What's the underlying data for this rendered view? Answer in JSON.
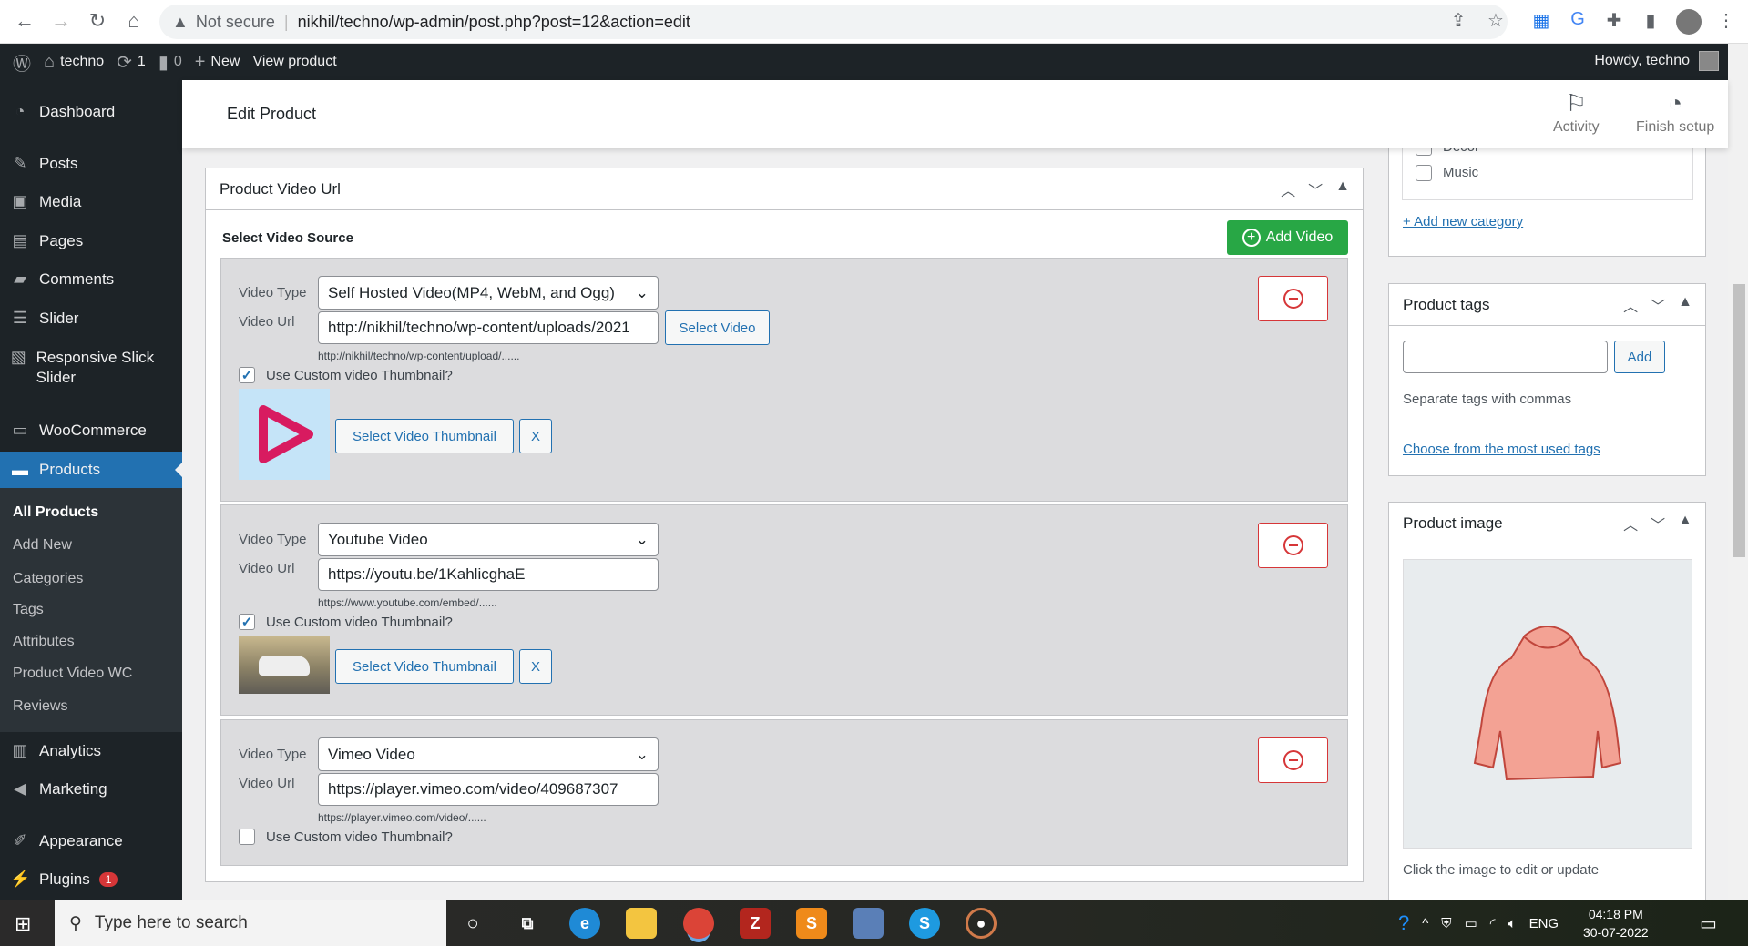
{
  "browser": {
    "security": "Not secure",
    "url": "nikhil/techno/wp-admin/post.php?post=12&action=edit"
  },
  "adminbar": {
    "site": "techno",
    "updates": "1",
    "comments": "0",
    "new": "New",
    "view": "View product",
    "howdy": "Howdy, techno"
  },
  "sidebar": {
    "items": [
      {
        "label": "Dashboard",
        "icon": "dashboard-icon"
      },
      {
        "label": "Posts",
        "icon": "pin-icon"
      },
      {
        "label": "Media",
        "icon": "media-icon"
      },
      {
        "label": "Pages",
        "icon": "pages-icon"
      },
      {
        "label": "Comments",
        "icon": "comment-icon"
      },
      {
        "label": "Slider",
        "icon": "list-icon"
      },
      {
        "label": "Responsive Slick Slider",
        "icon": "slider-icon"
      },
      {
        "label": "WooCommerce",
        "icon": "woo-icon"
      },
      {
        "label": "Products",
        "icon": "archive-icon"
      },
      {
        "label": "Analytics",
        "icon": "bar-chart-icon"
      },
      {
        "label": "Marketing",
        "icon": "megaphone-icon"
      },
      {
        "label": "Appearance",
        "icon": "brush-icon"
      },
      {
        "label": "Plugins",
        "icon": "plug-icon",
        "badge": "1"
      }
    ],
    "submenu": [
      "All Products",
      "Add New",
      "Categories",
      "Tags",
      "Attributes",
      "Product Video WC",
      "Reviews"
    ]
  },
  "header": {
    "title": "Edit Product",
    "activity": "Activity",
    "finish": "Finish setup"
  },
  "metabox": {
    "title": "Product Video Url",
    "source_label": "Select Video Source",
    "add_video": "Add Video",
    "type_label": "Video Type",
    "url_label": "Video Url",
    "thumb_label": "Use Custom video Thumbnail?",
    "select_video": "Select Video",
    "select_thumb": "Select Video Thumbnail",
    "remove_thumb": "X",
    "rows": [
      {
        "type": "Self Hosted Video(MP4, WebM, and Ogg)",
        "url": "http://nikhil/techno/wp-content/uploads/2021",
        "hint": "http://nikhil/techno/wp-content/upload/......",
        "custom_thumb": true
      },
      {
        "type": "Youtube Video",
        "url": "https://youtu.be/1KahlicghaE",
        "hint": "https://www.youtube.com/embed/......",
        "custom_thumb": true
      },
      {
        "type": "Vimeo Video",
        "url": "https://player.vimeo.com/video/409687307",
        "hint": "https://player.vimeo.com/video/......",
        "custom_thumb": false
      }
    ]
  },
  "categories": {
    "partial": "Decor",
    "music": "Music",
    "add_new": "+ Add new category"
  },
  "tags": {
    "title": "Product tags",
    "input": "",
    "add": "Add",
    "help": "Separate tags with commas",
    "choose": "Choose from the most used tags"
  },
  "image": {
    "title": "Product image",
    "help": "Click the image to edit or update"
  },
  "taskbar": {
    "search": "Type here to search",
    "lang": "ENG",
    "time": "04:18 PM",
    "date": "30-07-2022"
  },
  "colors": {
    "accent": "#2271b1",
    "add_video": "#28a745",
    "remove": "#d63638",
    "adminbar": "#1d2327"
  }
}
